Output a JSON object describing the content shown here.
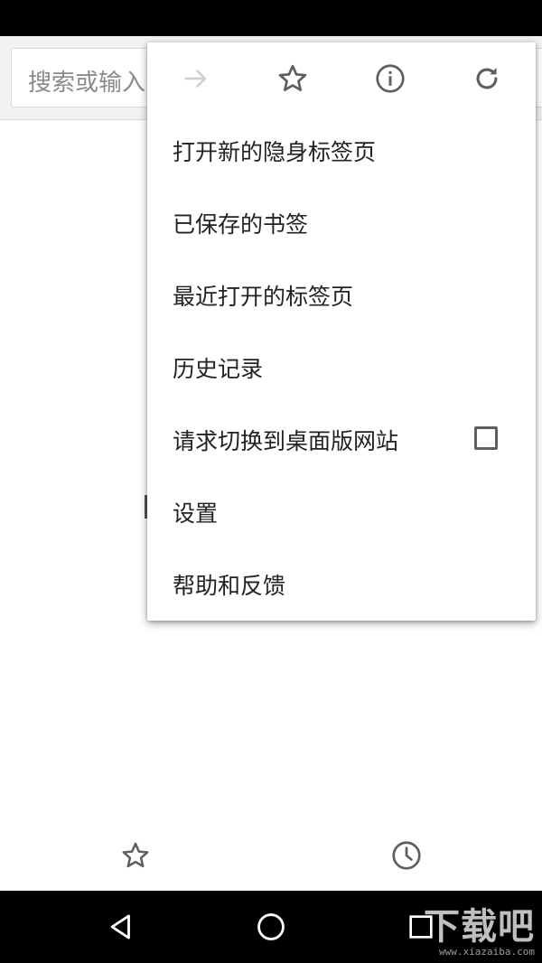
{
  "toolbar": {
    "omnibox_placeholder": "搜索或输入网址"
  },
  "menu": {
    "icons": [
      "forward-icon",
      "bookmark-star-icon",
      "info-icon",
      "reload-icon"
    ],
    "items": [
      {
        "label": "打开新的隐身标签页"
      },
      {
        "label": "已保存的书签"
      },
      {
        "label": "最近打开的标签页"
      },
      {
        "label": "历史记录"
      },
      {
        "label": "请求切换到桌面版网站",
        "checked": false
      },
      {
        "label": "设置"
      },
      {
        "label": "帮助和反馈"
      }
    ]
  },
  "bottom_toolbar": {
    "icons": [
      "bookmarks-star-icon",
      "recent-clock-icon"
    ]
  },
  "nav_bar": {
    "icons": [
      "back-triangle-icon",
      "home-circle-icon",
      "recents-square-icon"
    ]
  },
  "watermark": {
    "main": "下载吧",
    "sub": "www.xiazaiba.com"
  },
  "colors": {
    "status_bar": "#000000",
    "toolbar_bg": "#f2f2f2",
    "menu_text": "#222222",
    "icon_gray": "#5f5f5f",
    "icon_disabled": "#d0d0d0"
  }
}
